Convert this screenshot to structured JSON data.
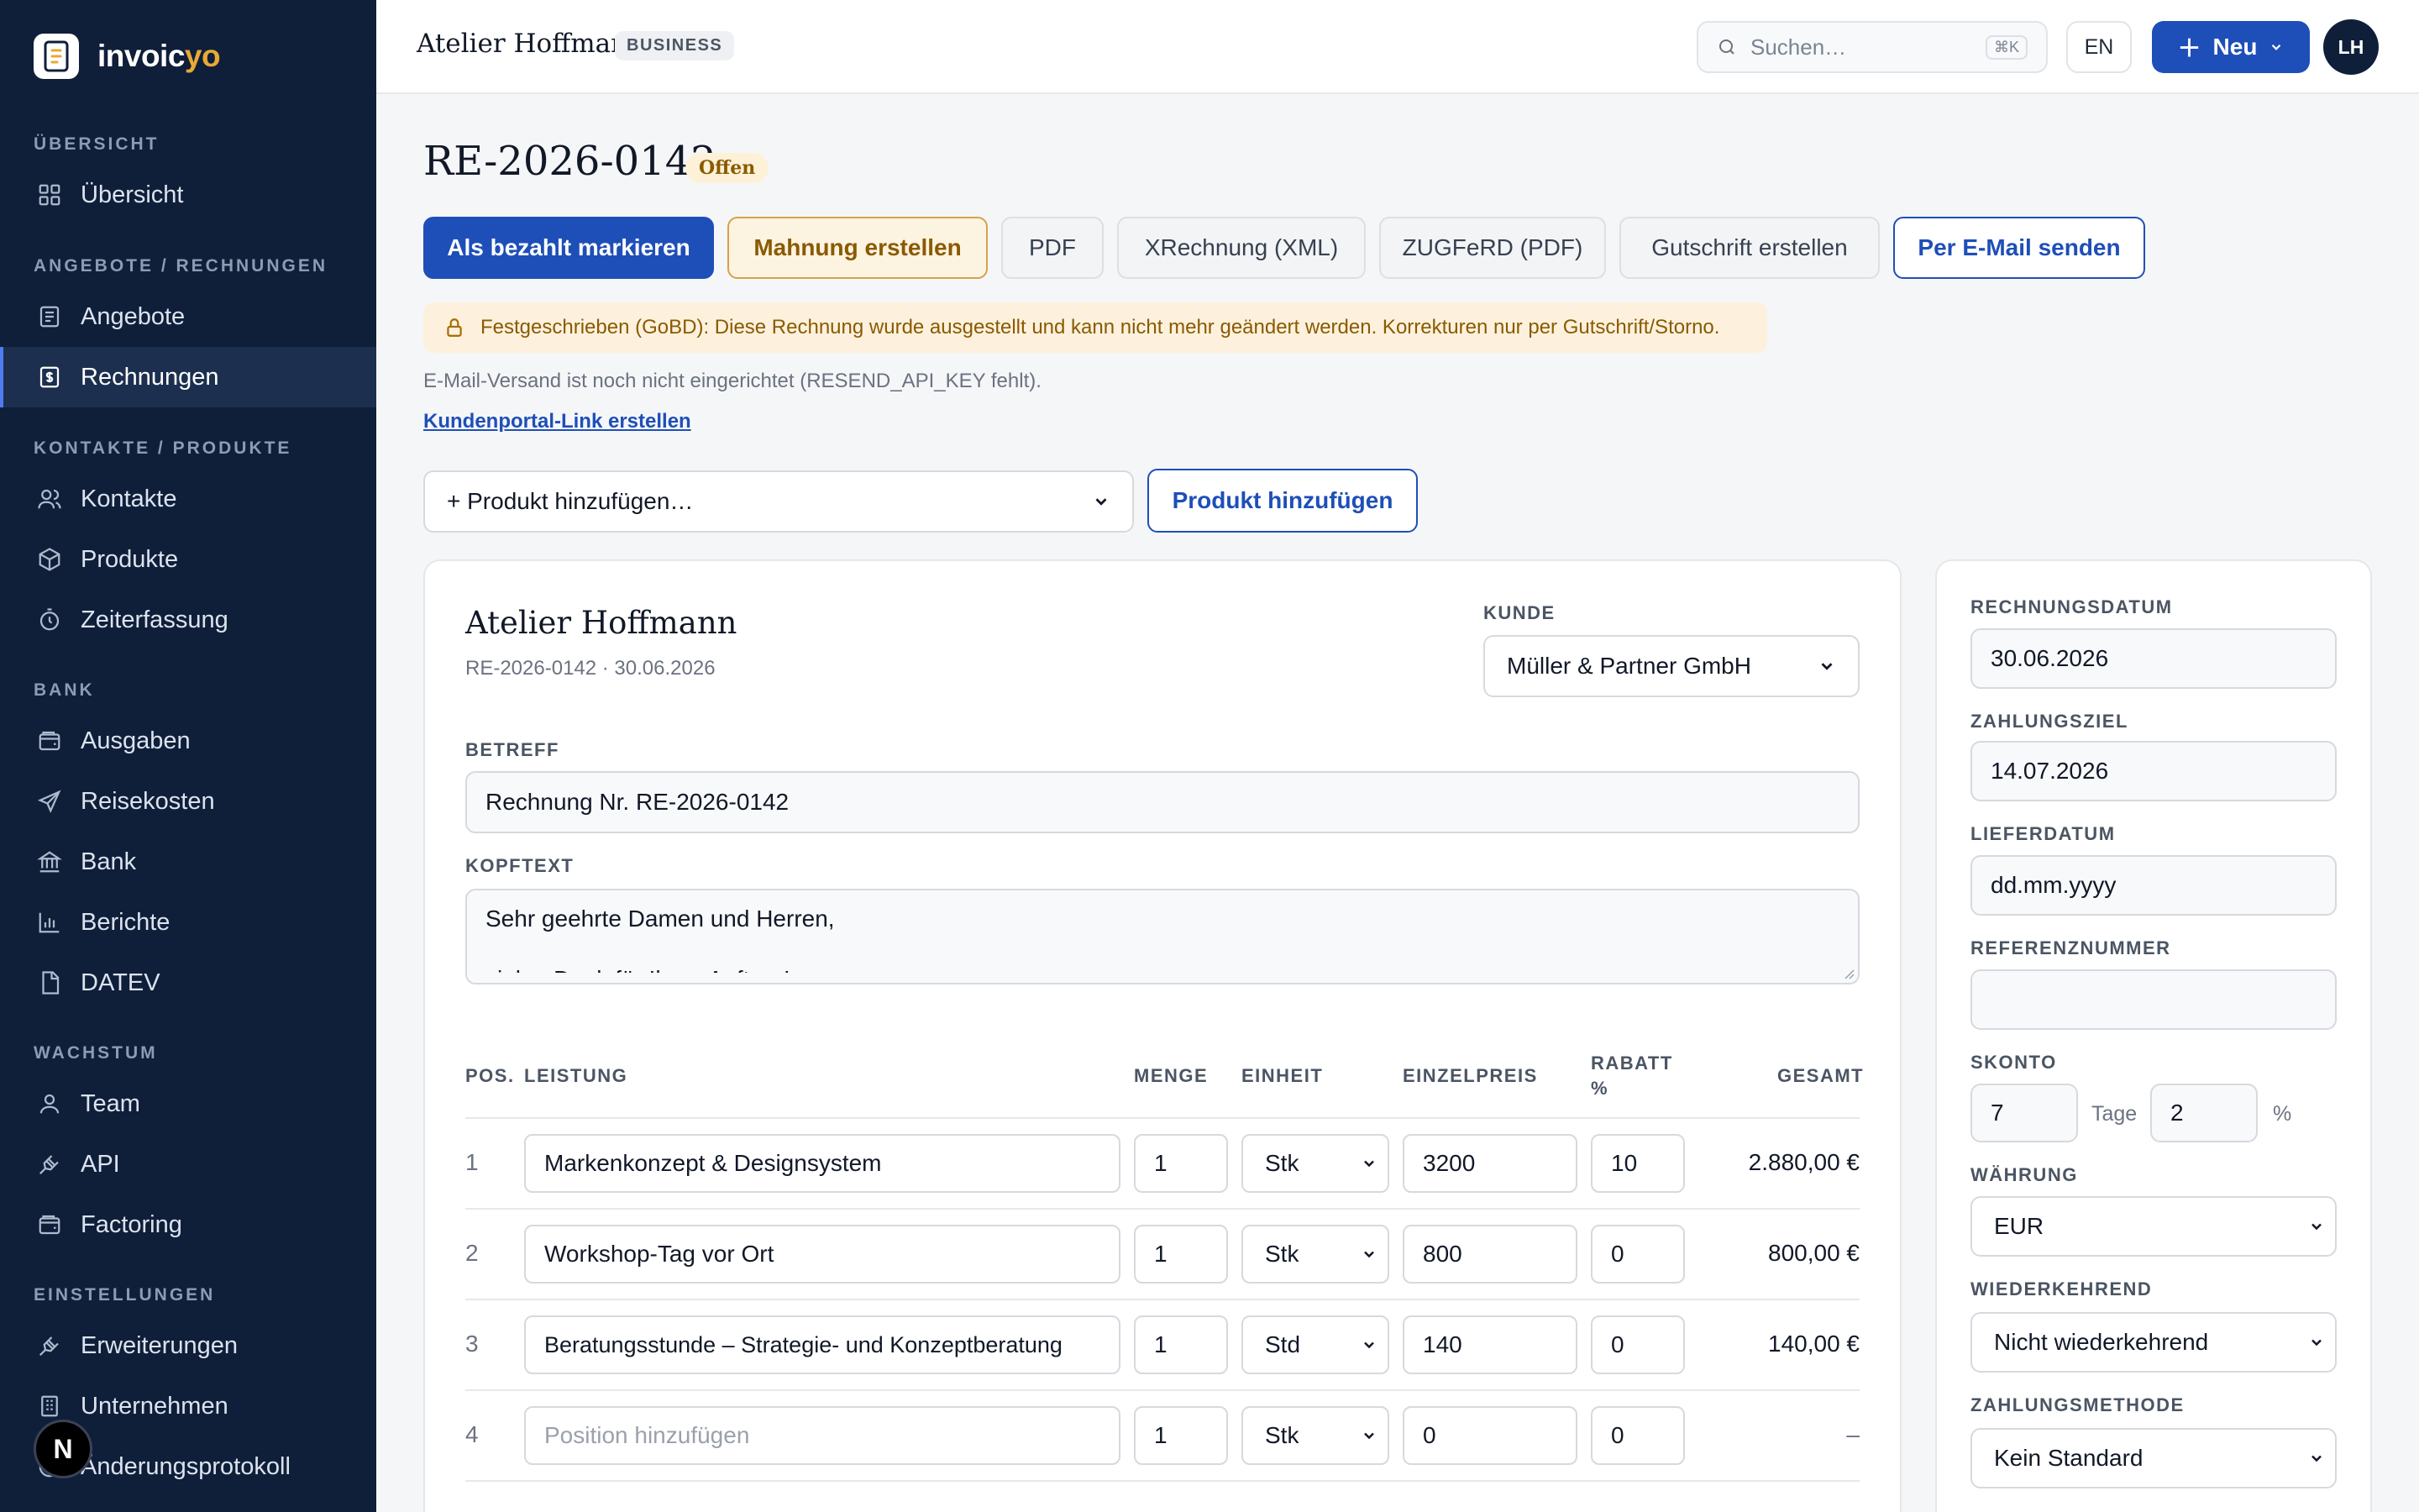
{
  "brand": {
    "name_main": "invoic",
    "name_accent": "yo"
  },
  "sidebar": {
    "sections": [
      "ÜBERSICHT",
      "ANGEBOTE / RECHNUNGEN",
      "KONTAKTE / PRODUKTE",
      "BANK",
      "WACHSTUM",
      "EINSTELLUNGEN"
    ],
    "items": [
      {
        "label": "Übersicht",
        "icon": "grid-icon"
      },
      {
        "label": "Angebote",
        "icon": "document-icon"
      },
      {
        "label": "Rechnungen",
        "icon": "invoice-icon",
        "active": true
      },
      {
        "label": "Kontakte",
        "icon": "users-icon"
      },
      {
        "label": "Produkte",
        "icon": "box-icon"
      },
      {
        "label": "Zeiterfassung",
        "icon": "stopwatch-icon"
      },
      {
        "label": "Ausgaben",
        "icon": "wallet-icon"
      },
      {
        "label": "Reisekosten",
        "icon": "plane-icon"
      },
      {
        "label": "Bank",
        "icon": "bank-icon"
      },
      {
        "label": "Berichte",
        "icon": "chart-icon"
      },
      {
        "label": "DATEV",
        "icon": "file-icon"
      },
      {
        "label": "Team",
        "icon": "user-icon"
      },
      {
        "label": "API",
        "icon": "plug-icon"
      },
      {
        "label": "Factoring",
        "icon": "wallet-icon"
      },
      {
        "label": "Erweiterungen",
        "icon": "plug-icon"
      },
      {
        "label": "Unternehmen",
        "icon": "building-icon"
      },
      {
        "label": "Änderungsprotokoll",
        "icon": "history-icon"
      }
    ],
    "fab_label": "N"
  },
  "topbar": {
    "org_name": "Atelier Hoffmann",
    "plan_badge": "BUSINESS",
    "search_placeholder": "Suchen…",
    "search_shortcut": "⌘K",
    "lang": "EN",
    "new_label": "Neu",
    "avatar_initials": "LH"
  },
  "invoice": {
    "number": "RE-2026-0142",
    "status": "Offen",
    "actions": {
      "mark_paid": "Als bezahlt markieren",
      "reminder": "Mahnung erstellen",
      "pdf": "PDF",
      "xrechnung": "XRechnung (XML)",
      "zugferd": "ZUGFeRD (PDF)",
      "credit_note": "Gutschrift erstellen",
      "email": "Per E-Mail senden"
    },
    "lock_notice": "Festgeschrieben (GoBD): Diese Rechnung wurde ausgestellt und kann nicht mehr geändert werden. Korrekturen nur per Gutschrift/Storno.",
    "email_note": "E-Mail-Versand ist noch nicht eingerichtet (RESEND_API_KEY fehlt).",
    "portal_link": "Kundenportal-Link erstellen",
    "product_select": "+ Produkt hinzufügen…",
    "add_product_button": "Produkt hinzufügen"
  },
  "editor": {
    "company": "Atelier Hoffmann",
    "meta": "RE-2026-0142 · 30.06.2026",
    "customer_label": "KUNDE",
    "customer_value": "Müller & Partner GmbH",
    "subject_label": "BETREFF",
    "subject_value": "Rechnung Nr. RE-2026-0142",
    "header_label": "KOPFTEXT",
    "header_line1": "Sehr geehrte Damen und Herren,",
    "header_line2": "vielen Dank für Ihren Auftrag!"
  },
  "table": {
    "headers": {
      "pos": "POS.",
      "service": "LEISTUNG",
      "qty": "MENGE",
      "unit": "EINHEIT",
      "price": "EINZELPREIS",
      "discount_1": "RABATT",
      "discount_2": "%",
      "total": "GESAMT"
    },
    "rows": [
      {
        "pos": "1",
        "service": "Markenkonzept & Designsystem",
        "qty": "1",
        "unit": "Stk",
        "price": "3200",
        "discount": "10",
        "total": "2.880,00 €"
      },
      {
        "pos": "2",
        "service": "Workshop-Tag vor Ort",
        "qty": "1",
        "unit": "Stk",
        "price": "800",
        "discount": "0",
        "total": "800,00 €"
      },
      {
        "pos": "3",
        "service": "Beratungsstunde – Strategie- und Konzeptberatung",
        "qty": "1",
        "unit": "Std",
        "price": "140",
        "discount": "0",
        "total": "140,00 €"
      },
      {
        "pos": "4",
        "service_placeholder": "Position hinzufügen",
        "qty": "1",
        "unit": "Stk",
        "price": "0",
        "discount": "0",
        "total": "–"
      }
    ]
  },
  "side_panel": {
    "invoice_date_label": "RECHNUNGSDATUM",
    "invoice_date": "30.06.2026",
    "due_label": "ZAHLUNGSZIEL",
    "due_date": "14.07.2026",
    "delivery_label": "LIEFERDATUM",
    "delivery_placeholder": "dd.mm.yyyy",
    "reference_label": "REFERENZNUMMER",
    "reference_value": "",
    "skonto_label": "SKONTO",
    "skonto_days": "7",
    "skonto_days_unit": "Tage",
    "skonto_percent": "2",
    "skonto_percent_unit": "%",
    "currency_label": "WÄHRUNG",
    "currency": "EUR",
    "recurring_label": "WIEDERKEHREND",
    "recurring": "Nicht wiederkehrend",
    "payment_label": "ZAHLUNGSMETHODE",
    "payment": "Kein Standard"
  },
  "colors": {
    "sidebar_bg": "#0f1f3a",
    "primary": "#1e4fb8",
    "accent": "#e8a935",
    "warn_bg": "#fdf1dd"
  }
}
